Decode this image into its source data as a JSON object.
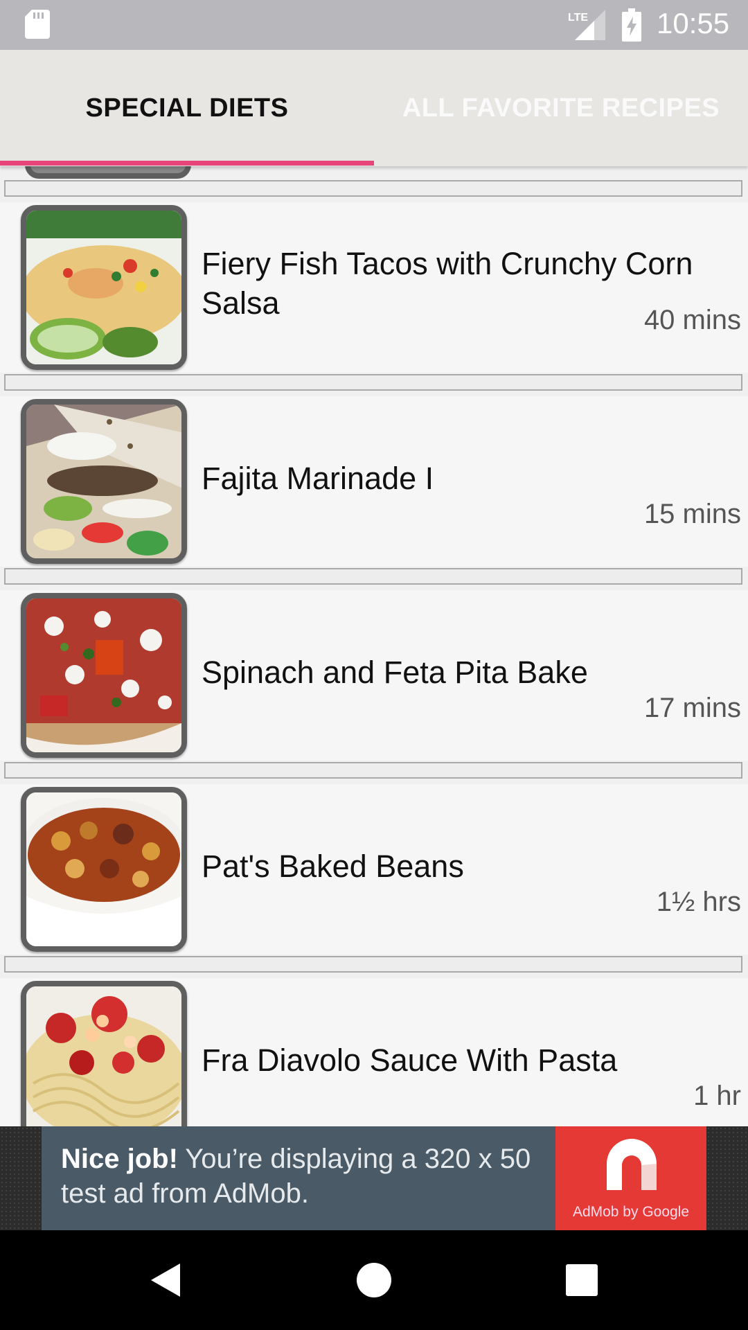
{
  "status_bar": {
    "time": "10:55",
    "network_label": "LTE",
    "icons": [
      "sd-card-icon",
      "lte-signal-icon",
      "battery-charging-icon"
    ]
  },
  "tabs": [
    {
      "label": "SPECIAL DIETS",
      "active": true
    },
    {
      "label": "ALL FAVORITE RECIPES",
      "active": false
    }
  ],
  "colors": {
    "tab_indicator": "#e6457a",
    "ad_background": "#4a5a66",
    "ad_logo_background": "#e43935"
  },
  "recipes": [
    {
      "title": "Fiery Fish Tacos with Crunchy Corn Salsa",
      "time": "40 mins"
    },
    {
      "title": "Fajita Marinade I",
      "time": "15 mins"
    },
    {
      "title": "Spinach and Feta Pita Bake",
      "time": "17 mins"
    },
    {
      "title": "Pat's Baked Beans",
      "time": "1½ hrs"
    },
    {
      "title": "Fra Diavolo Sauce With Pasta",
      "time": "1 hr"
    }
  ],
  "ad": {
    "headline": "Nice job!",
    "body": " You’re displaying a 320 x 50 test ad from AdMob.",
    "brand": "AdMob by Google"
  },
  "nav_bar": {
    "icons": [
      "back-icon",
      "home-icon",
      "recents-icon"
    ]
  }
}
